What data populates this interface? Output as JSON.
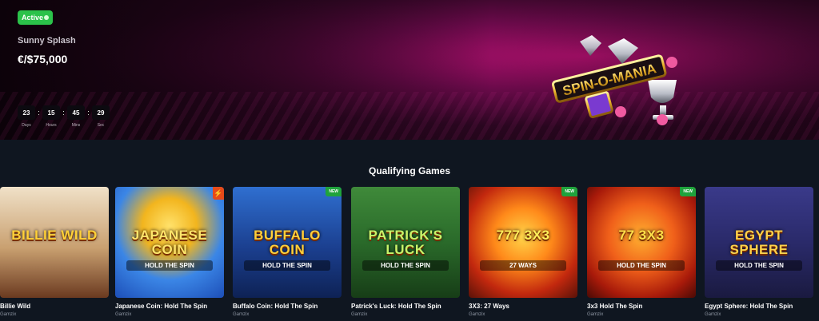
{
  "banner": {
    "status": "Active",
    "promo_name": "Sunny Splash",
    "prize": "€/$75,000",
    "logo_text": "SPIN-O-MANIA",
    "timer": [
      {
        "value": "23",
        "label": "Days"
      },
      {
        "value": "15",
        "label": "Hours"
      },
      {
        "value": "45",
        "label": "Mins"
      },
      {
        "value": "29",
        "label": "Sec"
      }
    ]
  },
  "section_title": "Qualifying Games",
  "games": [
    {
      "name": "Billie Wild",
      "provider": "Gamzix",
      "art_title": "BILLIE WILD",
      "art_sub": "",
      "tag": "",
      "bg": "linear-gradient(180deg,#f0e1c8 0%,#c9a070 55%,#6b3a20 100%)",
      "title_color": "#ffd23a"
    },
    {
      "name": "Japanese Coin: Hold The Spin",
      "provider": "Gamzix",
      "art_title": "JAPANESE COIN",
      "art_sub": "HOLD THE SPIN",
      "tag": "hot",
      "bg": "radial-gradient(circle at 50% 35%,#ffe16a 0%,#f2b51e 30%,#3b86e6 60%,#1d4fb8 100%)",
      "title_color": "#ffe56b"
    },
    {
      "name": "Buffalo Coin: Hold The Spin",
      "provider": "Gamzix",
      "art_title": "BUFFALO COIN",
      "art_sub": "HOLD THE SPIN",
      "tag": "new",
      "bg": "linear-gradient(180deg,#2f6fd0 0%,#1b3f8f 55%,#0e2255 100%)",
      "title_color": "#ffcf3a"
    },
    {
      "name": "Patrick's Luck: Hold The Spin",
      "provider": "Gamzix",
      "art_title": "PATRICK'S LUCK",
      "art_sub": "HOLD THE SPIN",
      "tag": "",
      "bg": "linear-gradient(180deg,#3f8a3a 0%,#2a6a2a 50%,#173d17 100%)",
      "title_color": "#c8f56b"
    },
    {
      "name": "3X3: 27 Ways",
      "provider": "Gamzix",
      "art_title": "777 3X3",
      "art_sub": "27 WAYS",
      "tag": "new",
      "bg": "radial-gradient(circle at 50% 45%,#ffd54a 0%,#ff8a1a 35%,#c2280e 70%,#5a1208 100%)",
      "title_color": "#ffef5a"
    },
    {
      "name": "3x3 Hold The Spin",
      "provider": "Gamzix",
      "art_title": "77 3X3",
      "art_sub": "HOLD THE SPIN",
      "tag": "new",
      "bg": "radial-gradient(circle at 50% 45%,#ffb030 0%,#f0601a 40%,#a81a0a 75%,#4a0a05 100%)",
      "title_color": "#ffe14a"
    },
    {
      "name": "Egypt Sphere: Hold The Spin",
      "provider": "Gamzix",
      "art_title": "EGYPT SPHERE",
      "art_sub": "HOLD THE SPIN",
      "tag": "",
      "bg": "linear-gradient(180deg,#3a3a8a 0%,#2a2a6a 50%,#1a1a40 100%)",
      "title_color": "#ffd24a"
    }
  ]
}
